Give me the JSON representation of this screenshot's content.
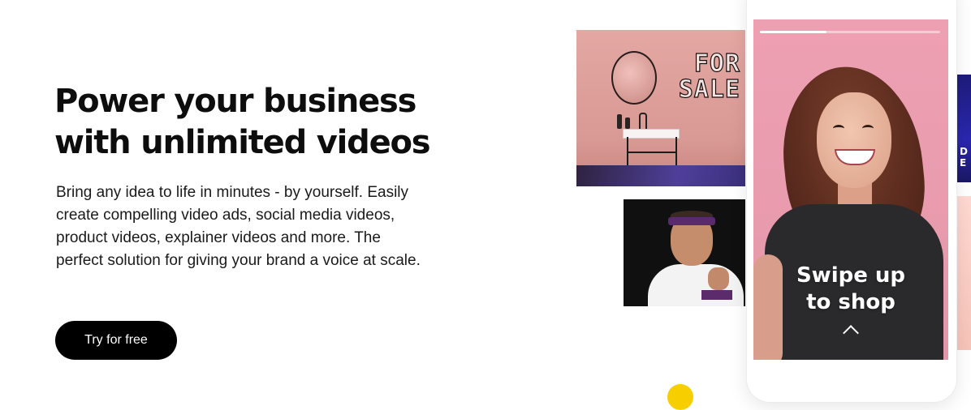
{
  "hero": {
    "title_line1": "Power your business",
    "title_line2": "with unlimited videos",
    "body": "Bring any idea to life in minutes - by yourself. Easily create compelling video ads, social media videos, product videos, explainer videos and more. The perfect solution for giving your brand a voice at scale.",
    "cta_label": "Try for free"
  },
  "gallery": {
    "bathroom_sign": "FOR SALE",
    "edge_glyphs": "D\nE"
  },
  "phone": {
    "story_progress": 0.37,
    "caption_line1": "Swipe up",
    "caption_line2": "to shop"
  },
  "icons": {
    "swipe": "chevron-up-icon"
  },
  "colors": {
    "cta_background": "#000000",
    "cta_text": "#ffffff",
    "phone_screen": "#e99bae",
    "accent_dot": "#f7ce00"
  }
}
